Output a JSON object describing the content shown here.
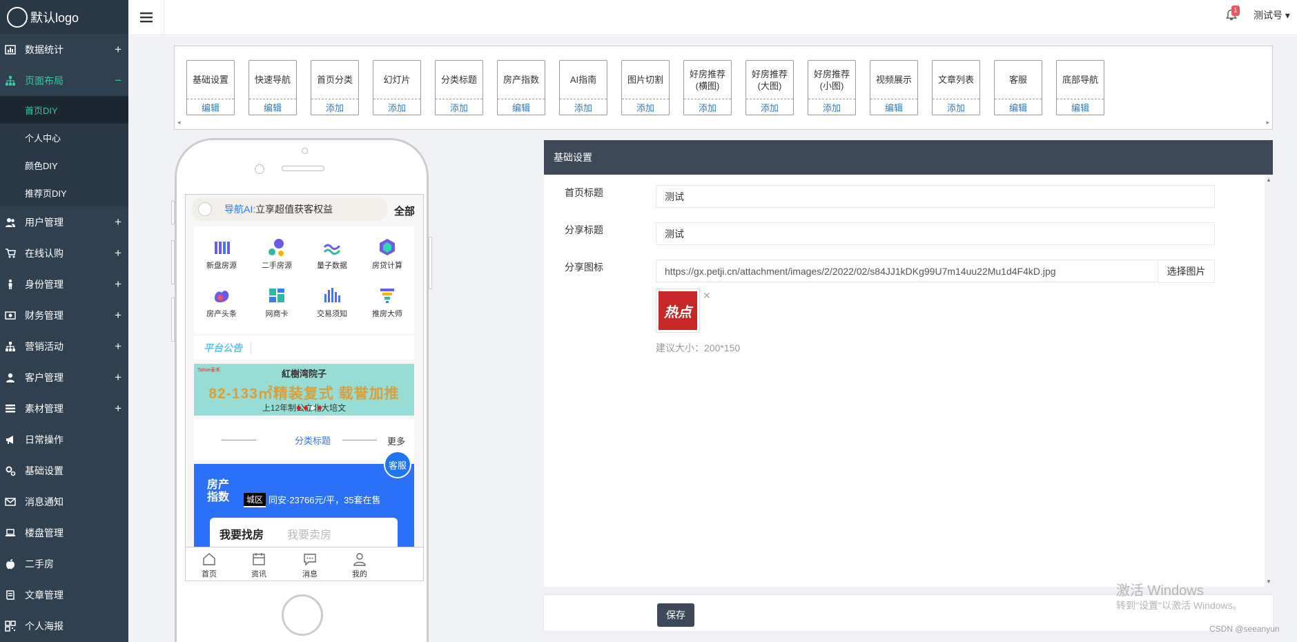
{
  "app": {
    "logo_text": "默认logo"
  },
  "sidebar": {
    "items": [
      {
        "label": "数据统计",
        "icon": "chart-icon",
        "expander": "+"
      },
      {
        "label": "页面布局",
        "icon": "sitemap-icon",
        "expander": "−",
        "active": true,
        "children": [
          {
            "label": "首页DIY",
            "active": true
          },
          {
            "label": "个人中心"
          },
          {
            "label": "颜色DIY"
          },
          {
            "label": "推荐页DIY"
          }
        ]
      },
      {
        "label": "用户管理",
        "icon": "users-icon",
        "expander": "+"
      },
      {
        "label": "在线认购",
        "icon": "cart-icon",
        "expander": "+"
      },
      {
        "label": "身份管理",
        "icon": "person-icon",
        "expander": "+"
      },
      {
        "label": "财务管理",
        "icon": "money-icon",
        "expander": "+"
      },
      {
        "label": "营销活动",
        "icon": "sitemap-icon",
        "expander": "+"
      },
      {
        "label": "客户管理",
        "icon": "user-icon",
        "expander": "+"
      },
      {
        "label": "素材管理",
        "icon": "list-icon",
        "expander": "+"
      },
      {
        "label": "日常操作",
        "icon": "bullhorn-icon",
        "expander": ""
      },
      {
        "label": "基础设置",
        "icon": "gears-icon",
        "expander": ""
      },
      {
        "label": "消息通知",
        "icon": "envelope-icon",
        "expander": ""
      },
      {
        "label": "楼盘管理",
        "icon": "laptop-icon",
        "expander": ""
      },
      {
        "label": "二手房",
        "icon": "apple-icon",
        "expander": ""
      },
      {
        "label": "文章管理",
        "icon": "book-icon",
        "expander": ""
      },
      {
        "label": "个人海报",
        "icon": "qrcode-icon",
        "expander": ""
      }
    ]
  },
  "topbar": {
    "notification_count": "1",
    "username": "测试号 ▾"
  },
  "toolbar": {
    "modules": [
      {
        "name": "基础设置",
        "action": "编辑"
      },
      {
        "name": "快速导航",
        "action": "编辑"
      },
      {
        "name": "首页分类",
        "action": "添加"
      },
      {
        "name": "幻灯片",
        "action": "添加"
      },
      {
        "name": "分类标题",
        "action": "添加"
      },
      {
        "name": "房产指数",
        "action": "编辑"
      },
      {
        "name": "AI指南",
        "action": "添加"
      },
      {
        "name": "图片切割",
        "action": "添加"
      },
      {
        "name": "好房推荐\n(横图)",
        "action": "添加"
      },
      {
        "name": "好房推荐\n(大图)",
        "action": "添加"
      },
      {
        "name": "好房推荐\n(小图)",
        "action": "添加"
      },
      {
        "name": "视频展示",
        "action": "编辑"
      },
      {
        "name": "文章列表",
        "action": "添加"
      },
      {
        "name": "客服",
        "action": "编辑"
      },
      {
        "name": "底部导航",
        "action": "编辑"
      }
    ]
  },
  "phone": {
    "search": {
      "ai": "导航AI:",
      "text": "立享超值获客权益",
      "all": "全部"
    },
    "grid": [
      {
        "label": "新盘房源",
        "icon": "new-house-icon"
      },
      {
        "label": "二手房源",
        "icon": "second-house-icon"
      },
      {
        "label": "量子数据",
        "icon": "data-wave-icon"
      },
      {
        "label": "房贷计算",
        "icon": "calculator-icon"
      },
      {
        "label": "房产头条",
        "icon": "headline-icon"
      },
      {
        "label": "网商卡",
        "icon": "card-icon"
      },
      {
        "label": "交易须知",
        "icon": "bar-chart-icon"
      },
      {
        "label": "推房大师",
        "icon": "funnel-icon"
      }
    ],
    "notice": "平台公告",
    "banner": {
      "tag": "Tahoe泰禾",
      "top": "紅樹湾院子",
      "mid": "82-133㎡精装复式 载誉加推",
      "bottom": "上12年制公立北大培文"
    },
    "category": {
      "title": "分类标题",
      "more": "更多"
    },
    "house_index": {
      "title_line1": "房产",
      "title_line2": "指数",
      "tag": "城区",
      "info": "同安-23766元/平，35套在售",
      "tab_find": "我要找房",
      "tab_sell": "我要卖房"
    },
    "kefu": "客服",
    "tabbar": [
      {
        "label": "首页",
        "icon": "home-icon"
      },
      {
        "label": "资讯",
        "icon": "calendar-icon"
      },
      {
        "label": "消息",
        "icon": "message-icon"
      },
      {
        "label": "我的",
        "icon": "profile-icon"
      }
    ]
  },
  "panel": {
    "title": "基础设置",
    "fields": {
      "home_title": {
        "label": "首页标题",
        "value": "测试"
      },
      "share_title": {
        "label": "分享标题",
        "value": "测试"
      },
      "share_icon": {
        "label": "分享图标",
        "value": "https://gx.petji.cn/attachment/images/2/2022/02/s84JJ1kDKg99U7m14uu22Mu1d4F4kD.jpg",
        "button": "选择图片",
        "thumb_text": "热点",
        "hint": "建议大小：200*150"
      }
    },
    "save": "保存"
  },
  "watermark": {
    "line1": "激活 Windows",
    "line2": "转到\"设置\"以激活 Windows。",
    "csdn": "CSDN @seeanyun"
  }
}
